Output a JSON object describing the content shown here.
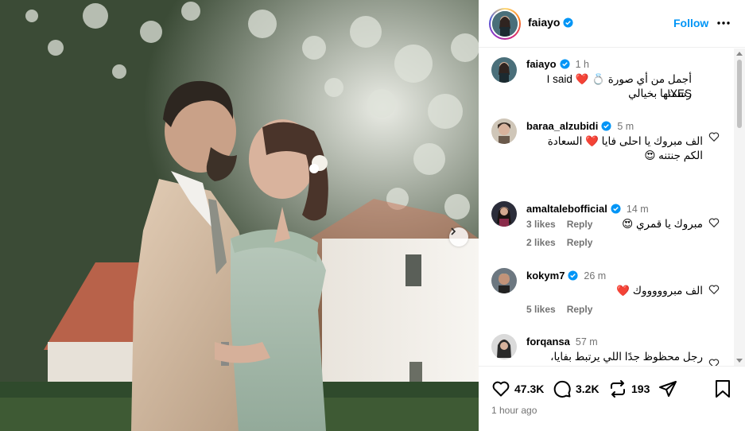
{
  "photo": {
    "description_icon": "chevron-right-icon"
  },
  "post": {
    "username": "faiayo",
    "follow_label": "Follow",
    "time_ago": "1 hour ago",
    "stats": {
      "likes": "47.3K",
      "comments": "3.2K",
      "reposts": "193"
    }
  },
  "caption": {
    "username": "faiayo",
    "time": "1 h",
    "line1": "أجمل من أي صورة 💍 ❤️ I said YES!",
    "line2": "رسمتها بخيالي"
  },
  "comments": [
    {
      "username": "baraa_alzubidi",
      "verified": true,
      "time": "5 m",
      "line1": "الف مبروك يا احلى فايا ❤️ السعادة",
      "line2": "الكم جنتنه 😍",
      "likes": "3 likes",
      "reply": "Reply"
    },
    {
      "username": "amaltalebofficial",
      "verified": true,
      "time": "14 m",
      "line1": "مبروك يا قمري 😍",
      "line2": "",
      "likes": "2 likes",
      "reply": "Reply"
    },
    {
      "username": "kokym7",
      "verified": true,
      "time": "26 m",
      "line1": "الف مبروووووك ❤️",
      "line2": "",
      "likes": "5 likes",
      "reply": "Reply"
    },
    {
      "username": "forqansa",
      "verified": false,
      "time": "57 m",
      "line1": "رجل محظوظ جدًا اللي يرتبط بفايا،",
      "line2": "",
      "likes": "",
      "reply": ""
    }
  ],
  "colors": {
    "accent": "#0095f6",
    "verified": "#0095f6",
    "muted": "#737373",
    "divider": "#efefef"
  }
}
